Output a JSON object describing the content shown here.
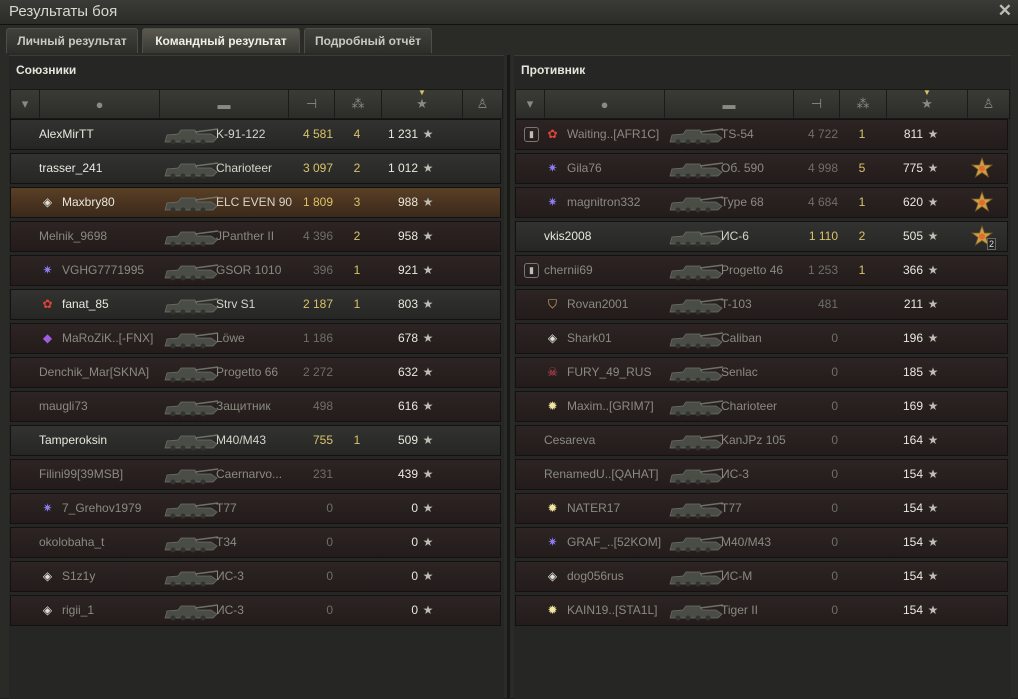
{
  "window": {
    "title": "Результаты боя",
    "close_icon": "✕"
  },
  "tabs": [
    {
      "label": "Личный результат"
    },
    {
      "label": "Командный результат"
    },
    {
      "label": "Подробный отчёт"
    }
  ],
  "allies": {
    "title": "Союзники",
    "rows": [
      {
        "name": "AlexMirTT",
        "tank": "K-91-122",
        "damage": "4 581",
        "kills": "4",
        "xp": "1 231",
        "badge": "",
        "alive": true
      },
      {
        "name": "trasser_241",
        "tank": "Charioteer",
        "damage": "3 097",
        "kills": "2",
        "xp": "1 012",
        "badge": "",
        "alive": true
      },
      {
        "name": "Maxbry80",
        "tank": "ELC EVEN 90",
        "damage": "1 809",
        "kills": "3",
        "xp": "988",
        "badge": "clan-diamond-icon",
        "alive": true,
        "me": true
      },
      {
        "name": "Melnik_9698",
        "tank": "JPanther II",
        "damage": "4 396",
        "kills": "2",
        "xp": "958",
        "badge": "",
        "alive": false
      },
      {
        "name": "VGHG7771995",
        "tank": "GSOR 1010",
        "damage": "396",
        "kills": "1",
        "xp": "921",
        "badge": "clan-star-icon",
        "alive": false
      },
      {
        "name": "fanat_85",
        "tank": "Strv S1",
        "damage": "2 187",
        "kills": "1",
        "xp": "803",
        "badge": "clan-flower-icon",
        "alive": true
      },
      {
        "name": "MaRoZiK..[-FNX]",
        "tank": "Löwe",
        "damage": "1 186",
        "kills": "",
        "xp": "678",
        "badge": "clan-purple-icon",
        "alive": false
      },
      {
        "name": "Denchik_Mar[SKNA]",
        "tank": "Progetto 66",
        "damage": "2 272",
        "kills": "",
        "xp": "632",
        "badge": "",
        "alive": false
      },
      {
        "name": "maugli73",
        "tank": "Защитник",
        "damage": "498",
        "kills": "",
        "xp": "616",
        "badge": "",
        "alive": false
      },
      {
        "name": "Tamperoksin",
        "tank": "M40/M43",
        "damage": "755",
        "kills": "1",
        "xp": "509",
        "badge": "",
        "alive": true
      },
      {
        "name": "Filini99[39MSB]",
        "tank": "Caernarvo...",
        "damage": "231",
        "kills": "",
        "xp": "439",
        "badge": "",
        "alive": false
      },
      {
        "name": "7_Grehov1979",
        "tank": "T77",
        "damage": "0",
        "kills": "",
        "xp": "0",
        "badge": "clan-star-icon",
        "alive": false
      },
      {
        "name": "okolobaha_t",
        "tank": "T34",
        "damage": "0",
        "kills": "",
        "xp": "0",
        "badge": "",
        "alive": false
      },
      {
        "name": "S1z1y",
        "tank": "ИС-3",
        "damage": "0",
        "kills": "",
        "xp": "0",
        "badge": "clan-diamond-icon",
        "alive": false
      },
      {
        "name": "rigii_1",
        "tank": "ИС-3",
        "damage": "0",
        "kills": "",
        "xp": "0",
        "badge": "clan-diamond-icon",
        "alive": false
      }
    ]
  },
  "enemies": {
    "title": "Противник",
    "rows": [
      {
        "name": "Waiting..[AFR1C]",
        "tank": "TS-54",
        "damage": "4 722",
        "kills": "1",
        "xp": "811",
        "badge": "clan-flower-icon",
        "alive": false,
        "platoon": true,
        "medal": ""
      },
      {
        "name": "Gila76",
        "tank": "Об. 590",
        "damage": "4 998",
        "kills": "5",
        "xp": "775",
        "badge": "clan-star-icon",
        "alive": false,
        "platoon": false,
        "medal": "medal-icon"
      },
      {
        "name": "magnitron332",
        "tank": "Type 68",
        "damage": "4 684",
        "kills": "1",
        "xp": "620",
        "badge": "clan-star-icon",
        "alive": false,
        "platoon": false,
        "medal": "medal-icon"
      },
      {
        "name": "vkis2008",
        "tank": "ИС-6",
        "damage": "1 110",
        "kills": "2",
        "xp": "505",
        "badge": "",
        "alive": true,
        "platoon": false,
        "medal": "medal-icon",
        "medal_count": "2"
      },
      {
        "name": "chernii69",
        "tank": "Progetto 46",
        "damage": "1 253",
        "kills": "1",
        "xp": "366",
        "badge": "",
        "alive": false,
        "platoon": true,
        "medal": ""
      },
      {
        "name": "Rovan2001",
        "tank": "T-103",
        "damage": "481",
        "kills": "",
        "xp": "211",
        "badge": "clan-shield-icon",
        "alive": false,
        "platoon": false,
        "medal": ""
      },
      {
        "name": "Shark01",
        "tank": "Caliban",
        "damage": "0",
        "kills": "",
        "xp": "196",
        "badge": "clan-diamond-icon",
        "alive": false,
        "platoon": false,
        "medal": ""
      },
      {
        "name": "FURY_49_RUS",
        "tank": "Senlac",
        "damage": "0",
        "kills": "",
        "xp": "185",
        "badge": "clan-skull-icon",
        "alive": false,
        "platoon": false,
        "medal": ""
      },
      {
        "name": "Maxim..[GRIM7]",
        "tank": "Charioteer",
        "damage": "0",
        "kills": "",
        "xp": "169",
        "badge": "clan-sun-icon",
        "alive": false,
        "platoon": false,
        "medal": ""
      },
      {
        "name": "Cesareva",
        "tank": "KanJPz 105",
        "damage": "0",
        "kills": "",
        "xp": "164",
        "badge": "",
        "alive": false,
        "platoon": false,
        "medal": ""
      },
      {
        "name": "RenamedU..[QAHAT]",
        "tank": "ИС-3",
        "damage": "0",
        "kills": "",
        "xp": "154",
        "badge": "",
        "alive": false,
        "platoon": false,
        "medal": ""
      },
      {
        "name": "NATER17",
        "tank": "T77",
        "damage": "0",
        "kills": "",
        "xp": "154",
        "badge": "clan-sun-icon",
        "alive": false,
        "platoon": false,
        "medal": ""
      },
      {
        "name": "GRAF_..[52KOM]",
        "tank": "M40/M43",
        "damage": "0",
        "kills": "",
        "xp": "154",
        "badge": "clan-star-icon",
        "alive": false,
        "platoon": false,
        "medal": ""
      },
      {
        "name": "dog056rus",
        "tank": "ИС-М",
        "damage": "0",
        "kills": "",
        "xp": "154",
        "badge": "clan-diamond-icon",
        "alive": false,
        "platoon": false,
        "medal": ""
      },
      {
        "name": "KAIN19..[STA1L]",
        "tank": "Tiger II",
        "damage": "0",
        "kills": "",
        "xp": "154",
        "badge": "clan-sun-icon",
        "alive": false,
        "platoon": false,
        "medal": ""
      }
    ]
  },
  "colors": {
    "damage_live": "#d9c36a",
    "row_dead": "#2d2423",
    "row_me": "#5a3f26"
  },
  "star_glyph": "★"
}
